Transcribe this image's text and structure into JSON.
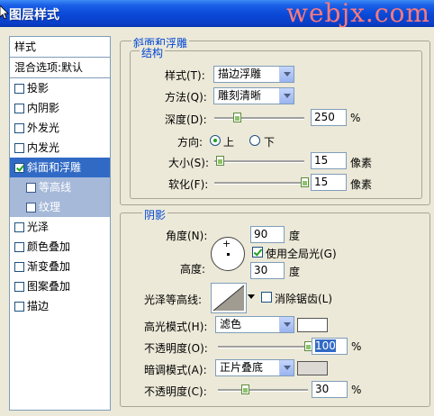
{
  "window": {
    "title": "图层样式",
    "watermark": "webjx.com"
  },
  "stylelist": {
    "header": "样式",
    "blend_options": "混合选项:默认",
    "items": [
      {
        "label": "投影",
        "checked": false
      },
      {
        "label": "内阴影",
        "checked": false
      },
      {
        "label": "外发光",
        "checked": false
      },
      {
        "label": "内发光",
        "checked": false
      },
      {
        "label": "斜面和浮雕",
        "checked": true
      },
      {
        "label": "等高线",
        "checked": false
      },
      {
        "label": "纹理",
        "checked": false
      },
      {
        "label": "光泽",
        "checked": false
      },
      {
        "label": "颜色叠加",
        "checked": false
      },
      {
        "label": "渐变叠加",
        "checked": false
      },
      {
        "label": "图案叠加",
        "checked": false
      },
      {
        "label": "描边",
        "checked": false
      }
    ]
  },
  "bevel": {
    "title": "斜面和浮雕",
    "structure": {
      "title": "结构",
      "style_label": "样式(T):",
      "style_value": "描边浮雕",
      "technique_label": "方法(Q):",
      "technique_value": "雕刻清晰",
      "depth_label": "深度(D):",
      "depth_value": "250",
      "depth_unit": "%",
      "depth_fraction": 0.25,
      "direction_label": "方向:",
      "direction_up": "上",
      "direction_down": "下",
      "direction_selected": "up",
      "size_label": "大小(S):",
      "size_value": "15",
      "size_unit": "像素",
      "size_fraction": 0.06,
      "soften_label": "软化(F):",
      "soften_value": "15",
      "soften_unit": "像素",
      "soften_fraction": 1.0
    },
    "shading": {
      "title": "阴影",
      "angle_label": "角度(N):",
      "angle_value": "90",
      "angle_unit": "度",
      "global_light_label": "使用全局光(G)",
      "global_light_checked": true,
      "altitude_label": "高度:",
      "altitude_value": "30",
      "altitude_unit": "度",
      "gloss_contour_label": "光泽等高线:",
      "anti_alias_label": "消除锯齿(L)",
      "anti_alias_checked": false,
      "highlight_mode_label": "高光模式(H):",
      "highlight_mode_value": "滤色",
      "highlight_color": "#ffffff",
      "highlight_opacity_label": "不透明度(O):",
      "highlight_opacity_value": "100",
      "highlight_opacity_unit": "%",
      "highlight_opacity_fraction": 1.0,
      "shadow_mode_label": "暗调模式(A):",
      "shadow_mode_value": "正片叠底",
      "shadow_color": "#dcd9d4",
      "shadow_opacity_label": "不透明度(C):",
      "shadow_opacity_value": "30",
      "shadow_opacity_unit": "%",
      "shadow_opacity_fraction": 0.3
    }
  },
  "colors": {
    "titlebar": "#0a48d6",
    "selection": "#316ac5",
    "legend": "#0046d5"
  }
}
